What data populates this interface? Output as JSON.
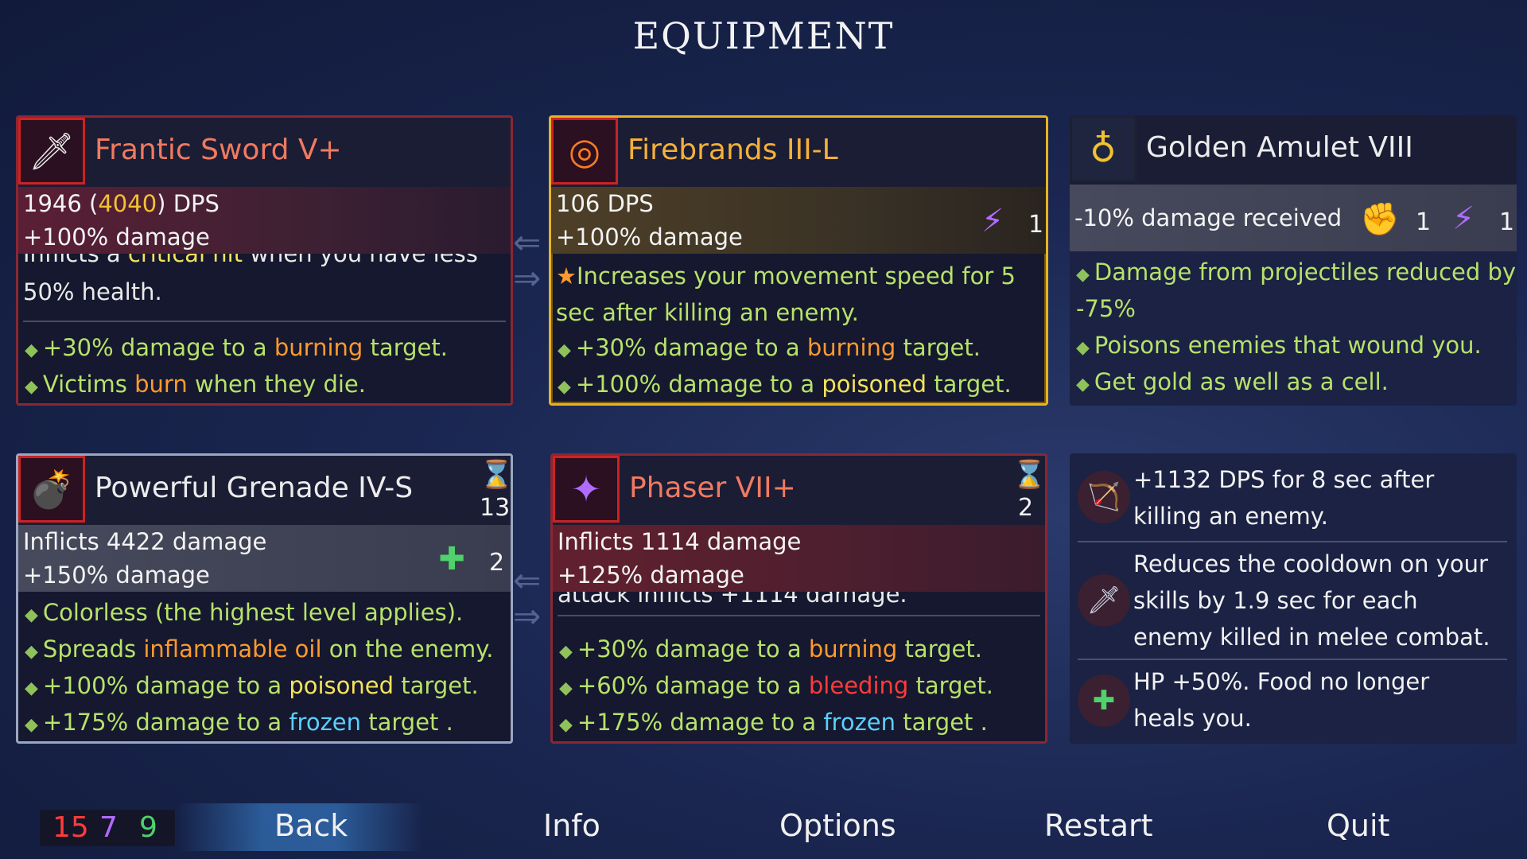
{
  "title": "EQUIPMENT",
  "weapon1": {
    "name": "Frantic Sword V+",
    "dps_base": "1946",
    "dps_crit": "4040",
    "dps_suffix": "DPS",
    "stat2": "+100% damage",
    "desc_a": "Inflicts a",
    "desc_crit": "critical hit",
    "desc_b": "when you have less than",
    "desc_c": "50% health.",
    "lines": [
      {
        "pre": "+30% damage to a",
        "kw": "burning",
        "post": "target."
      },
      {
        "pre": "Victims",
        "kw": "burn",
        "post": "when they die."
      }
    ]
  },
  "weapon2": {
    "name": "Firebrands III-L",
    "stat1": "106 DPS",
    "stat2": "+100% damage",
    "scroll_count": "1",
    "desc": "Increases your movement speed for 5 sec after killing an enemy.",
    "lines": [
      {
        "pre": "+30% damage to a",
        "kw": "burning",
        "post": "target."
      },
      {
        "pre": "+100% damage to a",
        "kw": "poisoned",
        "post": "target."
      }
    ]
  },
  "amulet": {
    "name": "Golden Amulet VIII",
    "stat1": "-10% damage received",
    "brutality_count": "1",
    "tactics_count": "1",
    "lines": [
      {
        "text": "Damage from projectiles reduced by"
      },
      {
        "text": "-75%"
      },
      {
        "text": "Poisons enemies that wound you."
      },
      {
        "text": "Get gold as well as a cell."
      }
    ]
  },
  "skill1": {
    "name": "Powerful Grenade IV-S",
    "cooldown": "13",
    "stat1": "Inflicts 4422 damage",
    "stat2": "+150% damage",
    "scroll_count": "2",
    "lines": [
      {
        "pre": "Colorless (the highest level applies).",
        "kw": "",
        "post": ""
      },
      {
        "pre": "Spreads",
        "kw": "inflammable oil",
        "post": "on the enemy."
      },
      {
        "pre": "+100% damage to a",
        "kw": "poisoned",
        "post": "target."
      },
      {
        "pre": "+175% damage to a",
        "kw": "frozen",
        "post": "target ."
      }
    ]
  },
  "skill2": {
    "name": "Phaser VII+",
    "cooldown": "2",
    "stat1": "Inflicts 1114 damage",
    "stat2": "+125% damage",
    "desc": "attack inflicts +1114 damage.",
    "lines": [
      {
        "pre": "+30% damage to a",
        "kw": "burning",
        "post": "target."
      },
      {
        "pre": "+60% damage to a",
        "kw": "bleeding",
        "post": "target."
      },
      {
        "pre": "+175% damage to a",
        "kw": "frozen",
        "post": "target ."
      }
    ]
  },
  "mutations": [
    {
      "icon": "bow-icon",
      "text": "+1132 DPS for 8 sec after killing an enemy."
    },
    {
      "icon": "dagger-icon",
      "text": "Reduces the cooldown on your skills by 1.9 sec for each enemy killed in melee combat."
    },
    {
      "icon": "heart-plus-icon",
      "text": "HP +50%. Food no longer heals you."
    }
  ],
  "scrolls": {
    "brutality": "15",
    "tactics": "7",
    "survival": "9"
  },
  "menu": {
    "back": "Back",
    "info": "Info",
    "options": "Options",
    "restart": "Restart",
    "quit": "Quit"
  },
  "colors": {
    "brutality": "#ff3b3b",
    "tactics": "#b06cff",
    "survival": "#4fd16b",
    "gold": "#e8b320"
  }
}
